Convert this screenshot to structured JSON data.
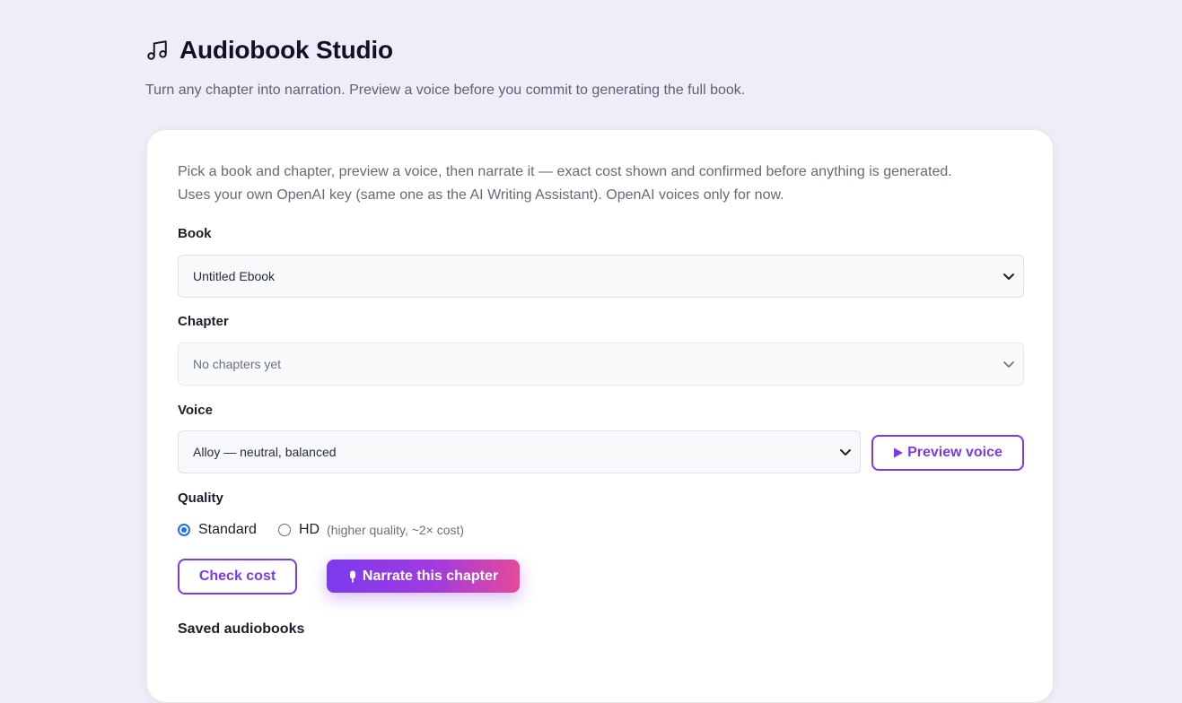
{
  "header": {
    "title": "Audiobook Studio",
    "subtitle": "Turn any chapter into narration. Preview a voice before you commit to generating the full book."
  },
  "card": {
    "intro_line1": "Pick a book and chapter, preview a voice, then narrate it — exact cost shown and confirmed before anything is generated.",
    "intro_line2": "Uses your own OpenAI key (same one as the AI Writing Assistant). OpenAI voices only for now.",
    "book": {
      "label": "Book",
      "value": "Untitled Ebook"
    },
    "chapter": {
      "label": "Chapter",
      "value": "No chapters yet"
    },
    "voice": {
      "label": "Voice",
      "value": "Alloy — neutral, balanced",
      "preview_label": "Preview voice"
    },
    "quality": {
      "label": "Quality",
      "options": [
        "Standard",
        "HD"
      ],
      "selected": "Standard",
      "hd_hint": "(higher quality, ~2× cost)"
    },
    "check_cost_label": "Check cost",
    "narrate_label": "Narrate this chapter",
    "saved_heading": "Saved audiobooks"
  },
  "colors": {
    "accent": "#7c3aed",
    "accent_end": "#e64a9a",
    "background": "#efedf8"
  },
  "icons": [
    "music-note-icon",
    "chevron-down-icon",
    "play-icon",
    "microphone-icon"
  ]
}
